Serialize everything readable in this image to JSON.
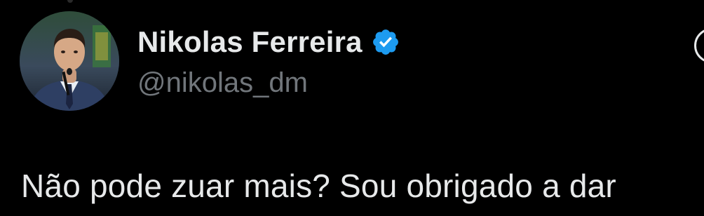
{
  "tweet": {
    "author": {
      "display_name": "Nikolas Ferreira",
      "handle": "@nikolas_dm",
      "verified": true,
      "avatar": "profile-photo"
    },
    "text": "Não pode zuar mais? Sou obrigado a dar"
  },
  "colors": {
    "background": "#000000",
    "primary_text": "#e7e9ea",
    "secondary_text": "#71767b",
    "verified_badge": "#1d9bf0"
  },
  "icons": {
    "verified": "verified-badge-icon",
    "more": "more-options-icon"
  }
}
